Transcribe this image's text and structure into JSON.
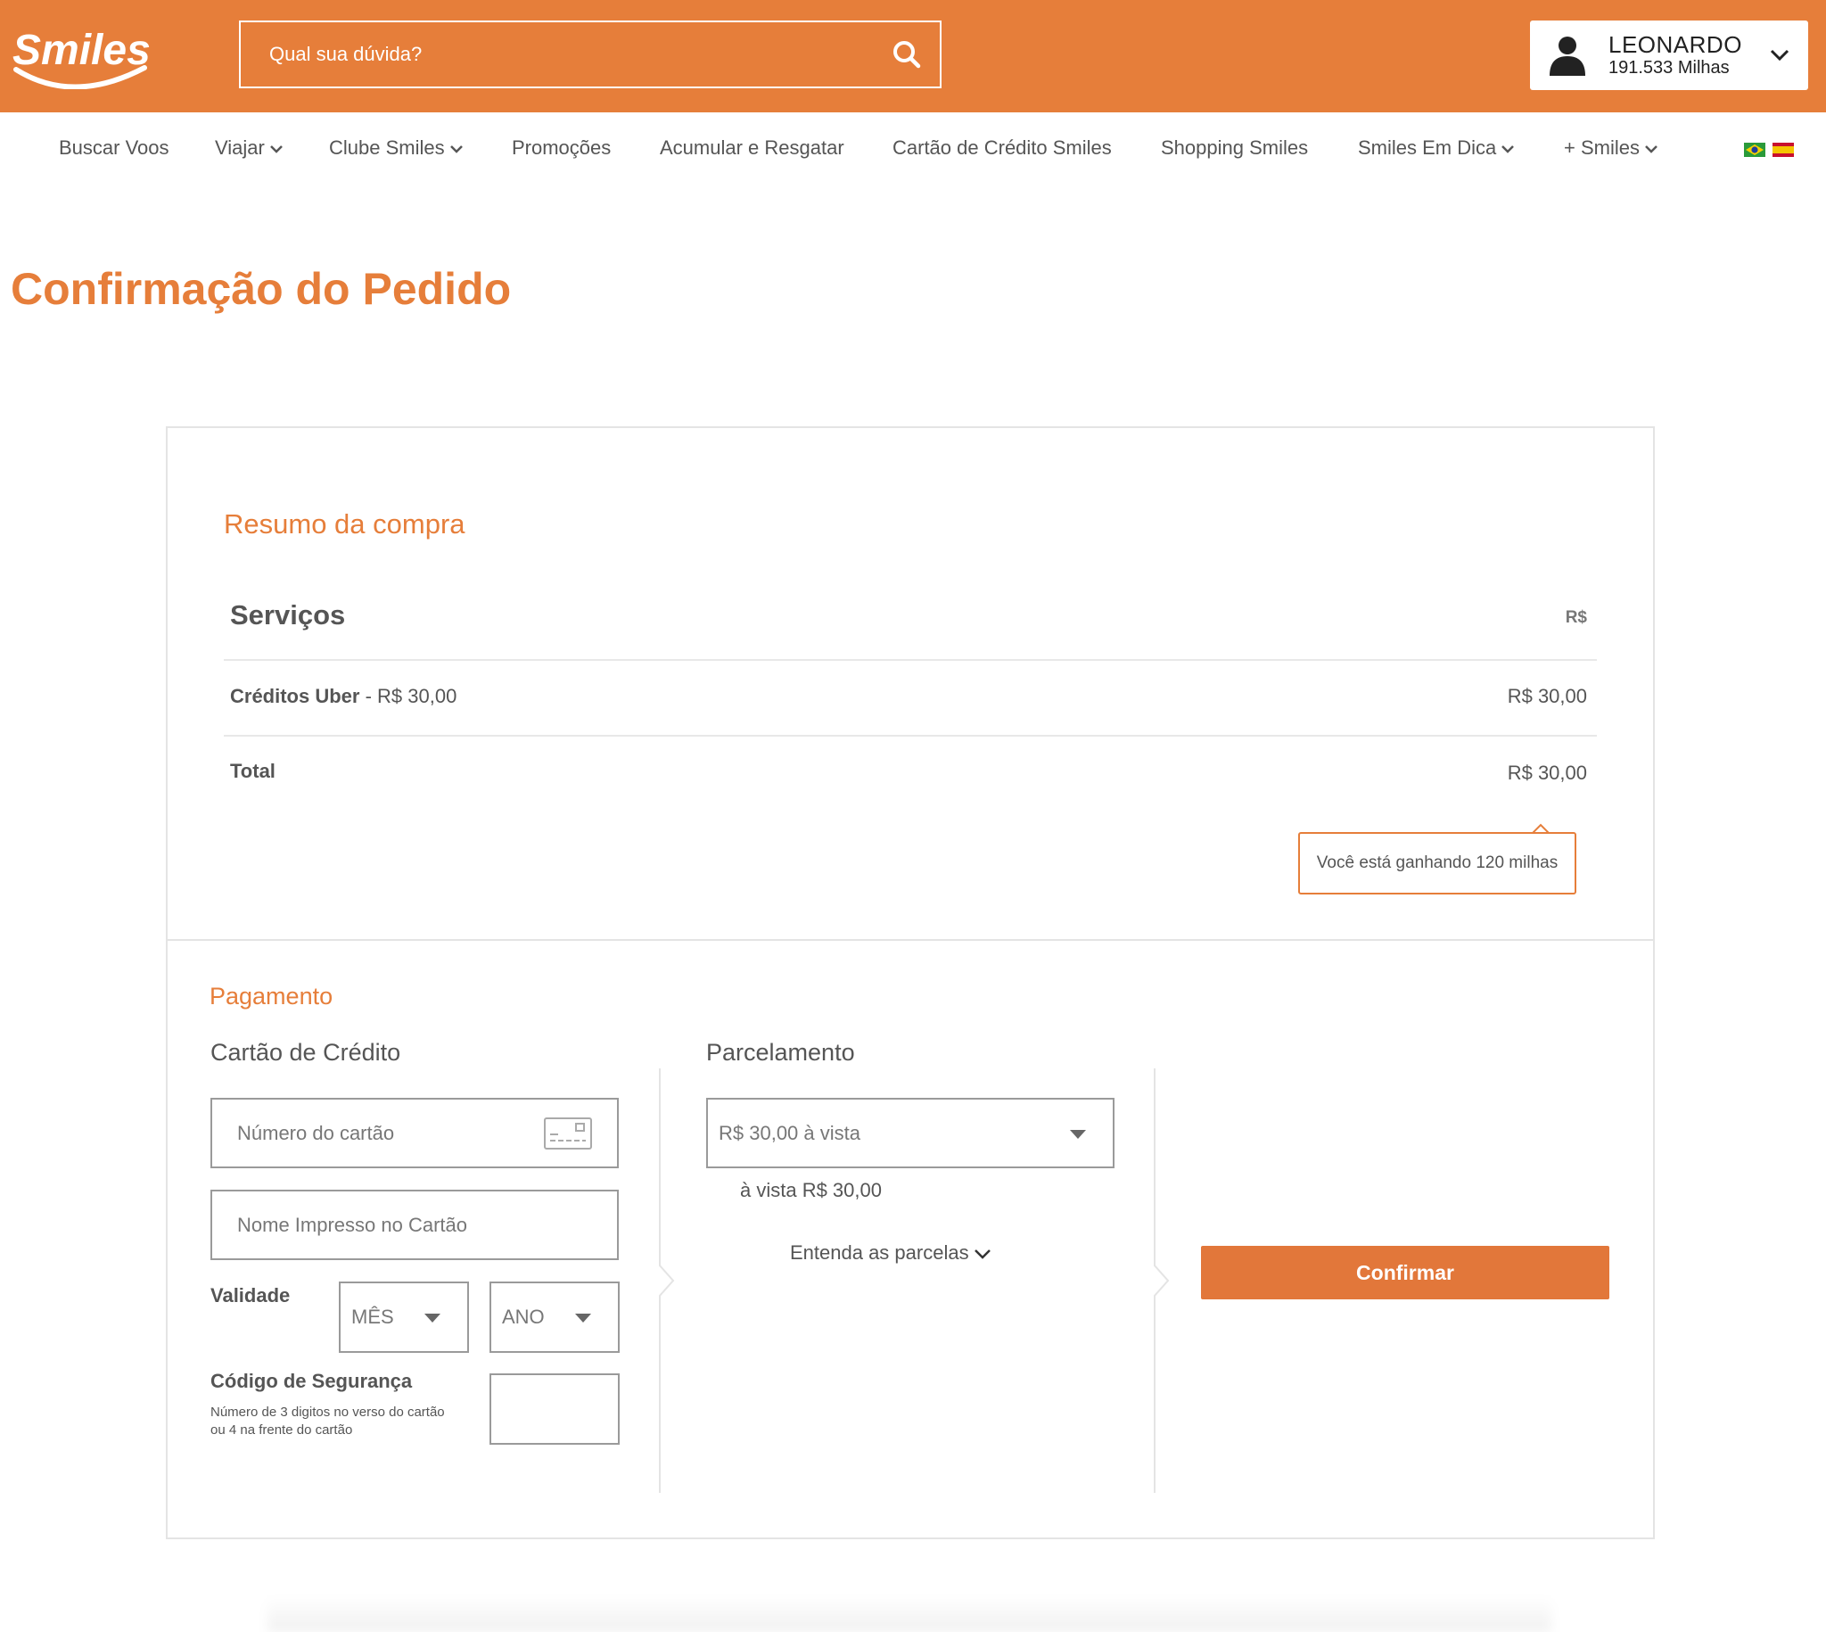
{
  "header": {
    "logo_text": "Smiles",
    "search_placeholder": "Qual sua dúvida?",
    "user": {
      "name": "LEONARDO",
      "miles": "191.533 Milhas"
    },
    "brand_color": "#e67e3a"
  },
  "nav": {
    "items": [
      {
        "label": "Buscar Voos",
        "dropdown": false
      },
      {
        "label": "Viajar",
        "dropdown": true
      },
      {
        "label": "Clube Smiles",
        "dropdown": true
      },
      {
        "label": "Promoções",
        "dropdown": false
      },
      {
        "label": "Acumular e Resgatar",
        "dropdown": false
      },
      {
        "label": "Cartão de Crédito Smiles",
        "dropdown": false
      },
      {
        "label": "Shopping Smiles",
        "dropdown": false
      },
      {
        "label": "Smiles Em Dica",
        "dropdown": true
      },
      {
        "label": "+ Smiles",
        "dropdown": true
      }
    ],
    "languages": [
      "brazil-flag-icon",
      "spain-flag-icon"
    ]
  },
  "page": {
    "title": "Confirmação do Pedido"
  },
  "summary": {
    "title": "Resumo da compra",
    "services_label": "Serviços",
    "currency_label": "R$",
    "item": {
      "name": "Créditos Uber",
      "detail": " - R$ 30,00",
      "price": "R$ 30,00"
    },
    "total_label": "Total",
    "total_value": "R$ 30,00",
    "miles_earned": "Você está ganhando 120 milhas"
  },
  "payment": {
    "title": "Pagamento",
    "credit_card": {
      "title": "Cartão de Crédito",
      "card_number_placeholder": "Número do cartão",
      "card_name_placeholder": "Nome Impresso no Cartão",
      "validity_label": "Validade",
      "month_placeholder": "MÊS",
      "year_placeholder": "ANO",
      "cvv_label": "Código de Segurança",
      "cvv_help_line1": "Número de 3 digitos no verso do cartão",
      "cvv_help_line2": "ou 4 na frente do cartão"
    },
    "installments": {
      "title": "Parcelamento",
      "selected": "R$ 30,00 à vista",
      "summary": "à vista R$ 30,00",
      "learn_more": "Entenda as parcelas"
    },
    "confirm_label": "Confirmar"
  }
}
